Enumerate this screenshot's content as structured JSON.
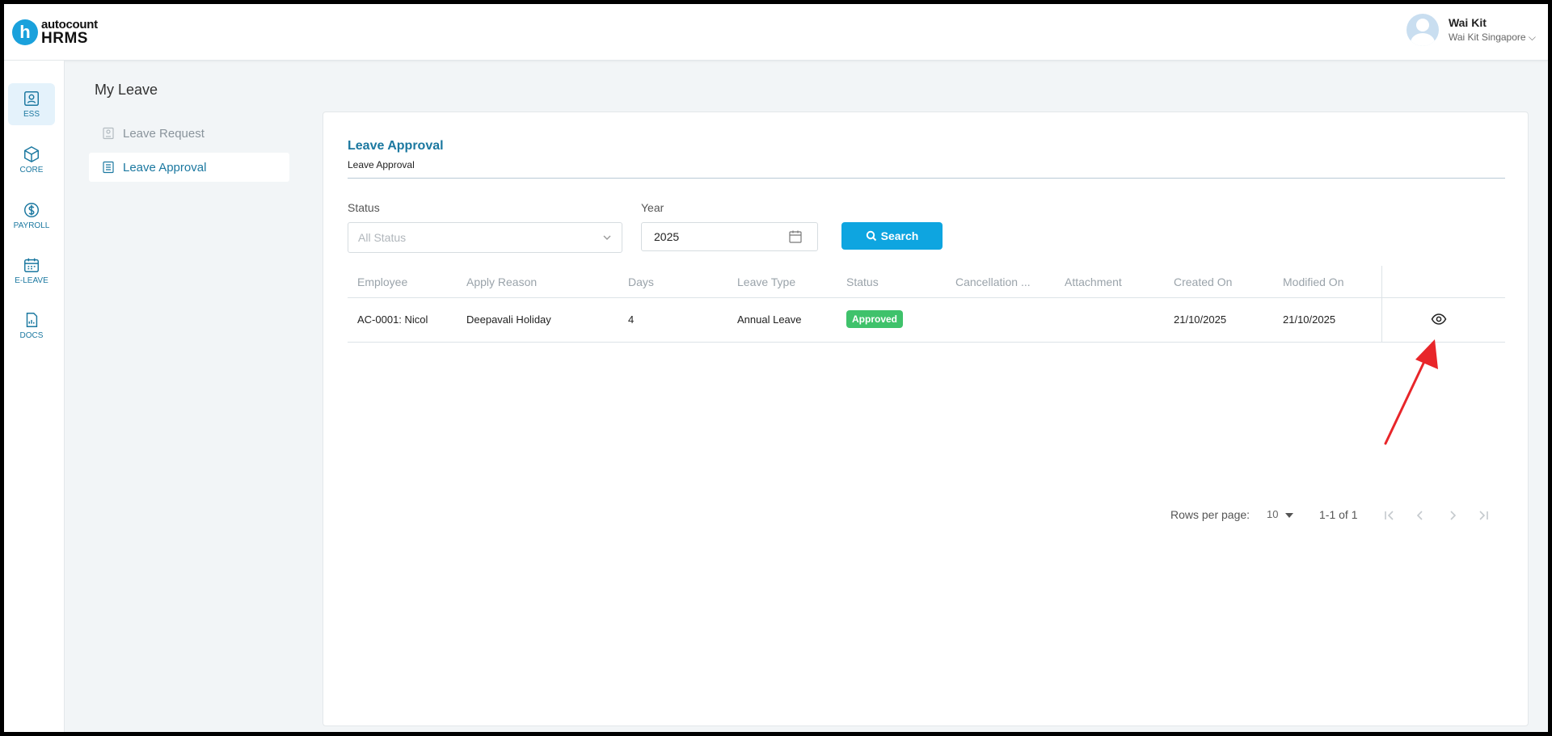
{
  "app": {
    "brand_small": "autocount",
    "brand_product": "HRMS",
    "logo_letter": "h"
  },
  "user": {
    "name": "Wai Kit",
    "company": "Wai Kit Singapore ⌵"
  },
  "rail": [
    {
      "label": "ESS",
      "icon": "ess-icon"
    },
    {
      "label": "CORE",
      "icon": "cube-icon"
    },
    {
      "label": "PAYROLL",
      "icon": "dollar-icon"
    },
    {
      "label": "E-LEAVE",
      "icon": "calendar-icon"
    },
    {
      "label": "DOCS",
      "icon": "document-icon"
    }
  ],
  "page": {
    "title": "My Leave",
    "subnav": [
      {
        "label": "Leave Request"
      },
      {
        "label": "Leave Approval"
      }
    ]
  },
  "card": {
    "title": "Leave Approval",
    "subtitle": "Leave Approval"
  },
  "filters": {
    "status_label": "Status",
    "status_placeholder": "All Status",
    "year_label": "Year",
    "year_value": "2025",
    "search_label": "Search"
  },
  "table": {
    "headers": [
      "Employee",
      "Apply Reason",
      "Days",
      "Leave Type",
      "Status",
      "Cancellation ...",
      "Attachment",
      "Created On",
      "Modified On"
    ],
    "rows": [
      {
        "employee": "AC-0001: Nicol",
        "reason": "Deepavali Holiday",
        "days": "4",
        "leave_type": "Annual Leave",
        "status": "Approved",
        "cancellation": "",
        "attachment": "",
        "created_on": "21/10/2025",
        "modified_on": "21/10/2025"
      }
    ]
  },
  "pagination": {
    "rows_per_page_label": "Rows per page:",
    "rows_per_page_value": "10",
    "range": "1-1 of 1"
  },
  "colors": {
    "accent": "#1b78a0",
    "button": "#0ea5e0",
    "approved": "#3fc26b",
    "annotation_arrow": "#e8262a"
  }
}
